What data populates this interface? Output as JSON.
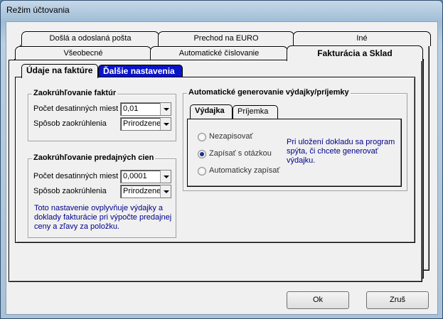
{
  "window": {
    "title": "Režim účtovania"
  },
  "tabs_row1": [
    "Došlá a odoslaná pošta",
    "Prechod na EURO",
    "Iné"
  ],
  "tabs_row2": [
    "Všeobecné",
    "Automatické číslovanie",
    "Fakturácia a Sklad"
  ],
  "inner_tabs": [
    "Údaje na faktúre",
    "Ďalšie nastavenia"
  ],
  "group_invoice": {
    "title": "Zaokrúhľovanie faktúr",
    "decimals_label": "Počet desatinných miest",
    "decimals_value": "0,01",
    "method_label": "Spôsob zaokrúhlenia",
    "method_value": "Prirodzene"
  },
  "group_sales": {
    "title": "Zaokrúhľovanie predajných cien",
    "decimals_label": "Počet desatinných miest",
    "decimals_value": "0,0001",
    "method_label": "Spôsob zaokrúhlenia",
    "method_value": "Prirodzene",
    "note": "Toto nastavenie ovplyvňuje výdajky a doklady fakturácie pri výpočte predajnej ceny a zľavy za položku."
  },
  "group_auto": {
    "title": "Automatické generovanie výdajky/príjemky",
    "tabs": [
      "Výdajka",
      "Príjemka"
    ],
    "options": [
      "Nezapisovať",
      "Zapísať s otázkou",
      "Automaticky zapísať"
    ],
    "selected": "Zapísať s otázkou",
    "note": "Pri uložení dokladu sa program spýta, či chcete generovať výdajku."
  },
  "buttons": {
    "ok": "Ok",
    "cancel": "Zruš"
  }
}
